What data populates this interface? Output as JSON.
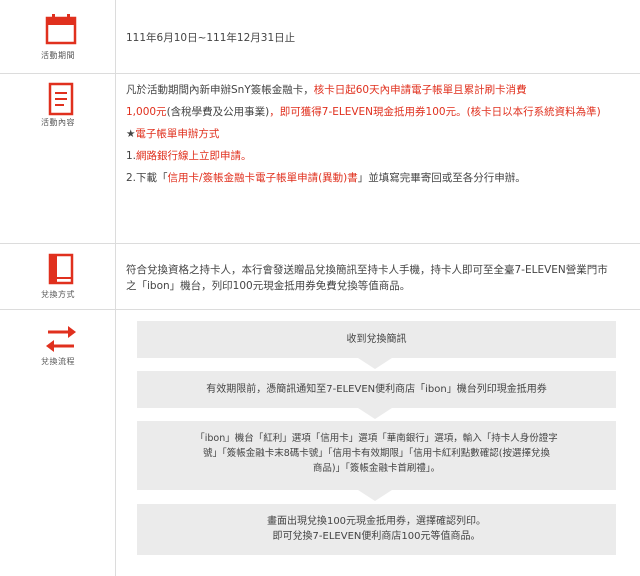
{
  "rows": {
    "period": {
      "label": "活動期間",
      "icon": "calendar-icon",
      "text": "111年6月10日~111年12月31日止"
    },
    "content": {
      "label": "活動內容",
      "icon": "document-icon",
      "line1_a": "凡於活動期間內新申辦SnY簽帳金融卡，",
      "line1_b": "核卡日起60天內申請電子帳單且累計刷卡消費",
      "line2_a": "1,000元",
      "line2_b": "(含稅學費及公用事業)",
      "line2_c": "，即可獲得7-ELEVEN現金抵用券100元。(核卡日以本行系統資料為準)",
      "line3_a": "★",
      "line3_b": "電子帳單申辦方式",
      "line4_a": "1.",
      "line4_b": "網路銀行線上立即申請。",
      "line5_a": "2.下載「",
      "line5_b": "信用卡/簽帳金融卡電子帳單申請(異動)書",
      "line5_c": "」並填寫完畢寄回或至各分行申辦。"
    },
    "redeem_method": {
      "label": "兌換方式",
      "icon": "book-icon",
      "line1": "符合兌換資格之持卡人，本行會發送贈品兌換簡訊至持卡人手機，持卡人即可至全臺7-ELEVEN營業門市",
      "line2": "之「ibon」機台，列印100元現金抵用券免費兌換等值商品。"
    },
    "redeem_flow": {
      "label": "兌換流程",
      "icon": "exchange-arrows-icon",
      "step1": "收到兌換簡訊",
      "step2": "有效期限前，憑簡訊通知至7-ELEVEN便利商店「ibon」機台列印現金抵用券",
      "step3_l1": "「ibon」機台「紅利」選項「信用卡」選項「華南銀行」選項，輸入「持卡人身份證字",
      "step3_l2": "號」「簽帳金融卡末8碼卡號」「信用卡有效期限」「信用卡紅利點數確認(按選擇兌換",
      "step3_l3": "商品)」「簽帳金融卡首刷禮」。",
      "step4_l1": "畫面出現兌換100元現金抵用券，選擇確認列印。",
      "step4_l2": "即可兌換7-ELEVEN便利商店100元等值商品。"
    }
  },
  "colors": {
    "accent_red": "#e0301e",
    "flow_box": "#ebebeb",
    "divider": "#dcdcdc"
  }
}
